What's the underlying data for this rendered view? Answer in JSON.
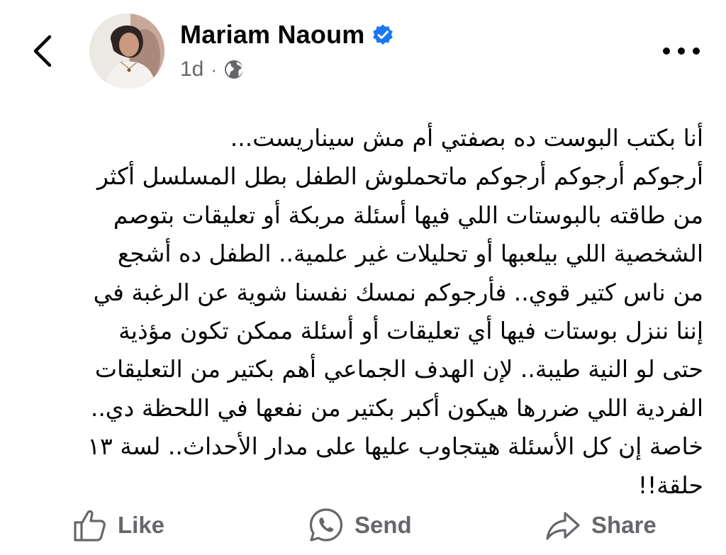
{
  "post": {
    "author": "Mariam Naoum",
    "time": "1d",
    "separator": "·",
    "text_lines": [
      "أنا بكتب البوست ده بصفتي أم مش سيناريست...",
      "أرجوكم أرجوكم أرجوكم ماتحملوش الطفل بطل المسلسل أكثر",
      "من طاقته بالبوستات اللي فيها أسئلة مربكة أو تعليقات بتوصم",
      "الشخصية اللي بيلعبها أو تحليلات غير علمية.. الطفل ده أشجع",
      "من ناس كتير قوي.. فأرجوكم نمسك نفسنا شوية عن الرغبة في",
      "إننا ننزل بوستات فيها أي تعليقات أو أسئلة ممكن تكون مؤذية",
      "حتى لو النية طيبة.. لإن الهدف الجماعي أهم بكتير من التعليقات",
      "الفردية اللي ضررها هيكون أكبر بكتير من نفعها في اللحظة دي..",
      "خاصة إن كل الأسئلة هيتجاوب عليها على مدار الأحداث.. لسة ١٣",
      "حلقة!!"
    ]
  },
  "icons": {
    "back": "chevron-left-icon",
    "verified": "verified-badge-icon",
    "audience": "globe-icon",
    "more": "more-dots-icon",
    "like": "thumbs-up-icon",
    "send": "whatsapp-icon",
    "share": "share-arrow-icon"
  },
  "actions": {
    "like": "Like",
    "send": "Send",
    "share": "Share"
  },
  "colors": {
    "text": "#050505",
    "secondary": "#65676b",
    "verified": "#1877f2",
    "background": "#ffffff"
  }
}
